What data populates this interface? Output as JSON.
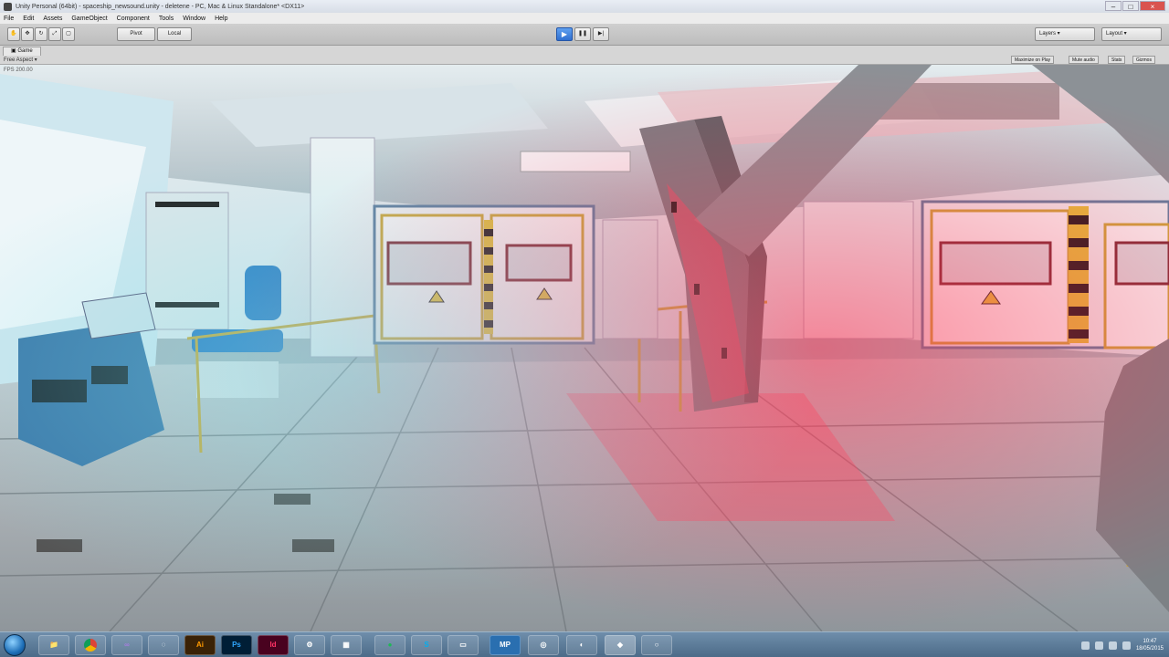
{
  "window": {
    "title": "Unity Personal (64bit) - spaceship_newsound.unity - deletene - PC, Mac & Linux Standalone* <DX11>"
  },
  "menu": [
    "File",
    "Edit",
    "Assets",
    "GameObject",
    "Component",
    "Tools",
    "Window",
    "Help"
  ],
  "toolbar": {
    "pivot_label": "Pivot",
    "local_label": "Local",
    "layers_label": "Layers",
    "layout_label": "Layout"
  },
  "game": {
    "tab_label": "Game",
    "aspect_label": "Free Aspect",
    "maximize_label": "Maximize on Play",
    "mute_label": "Mute audio",
    "stats_label": "Stats",
    "gizmos_label": "Gizmos",
    "fps_readout": "FPS 200.00"
  },
  "taskbar": {
    "apps": [
      "explorer",
      "chrome",
      "visual-studio",
      "app",
      "illustrator",
      "photoshop",
      "indesign",
      "steam",
      "app",
      "spotify",
      "skype",
      "app",
      "mp",
      "app",
      "unity-icon",
      "unity",
      "app"
    ],
    "mp_label": "MP",
    "time": "10:47",
    "date": "18/05/2015"
  },
  "colors": {
    "accent_play": "#3a7bd5",
    "red_light": "#e0455a",
    "teal_light": "#6fcfd9"
  }
}
